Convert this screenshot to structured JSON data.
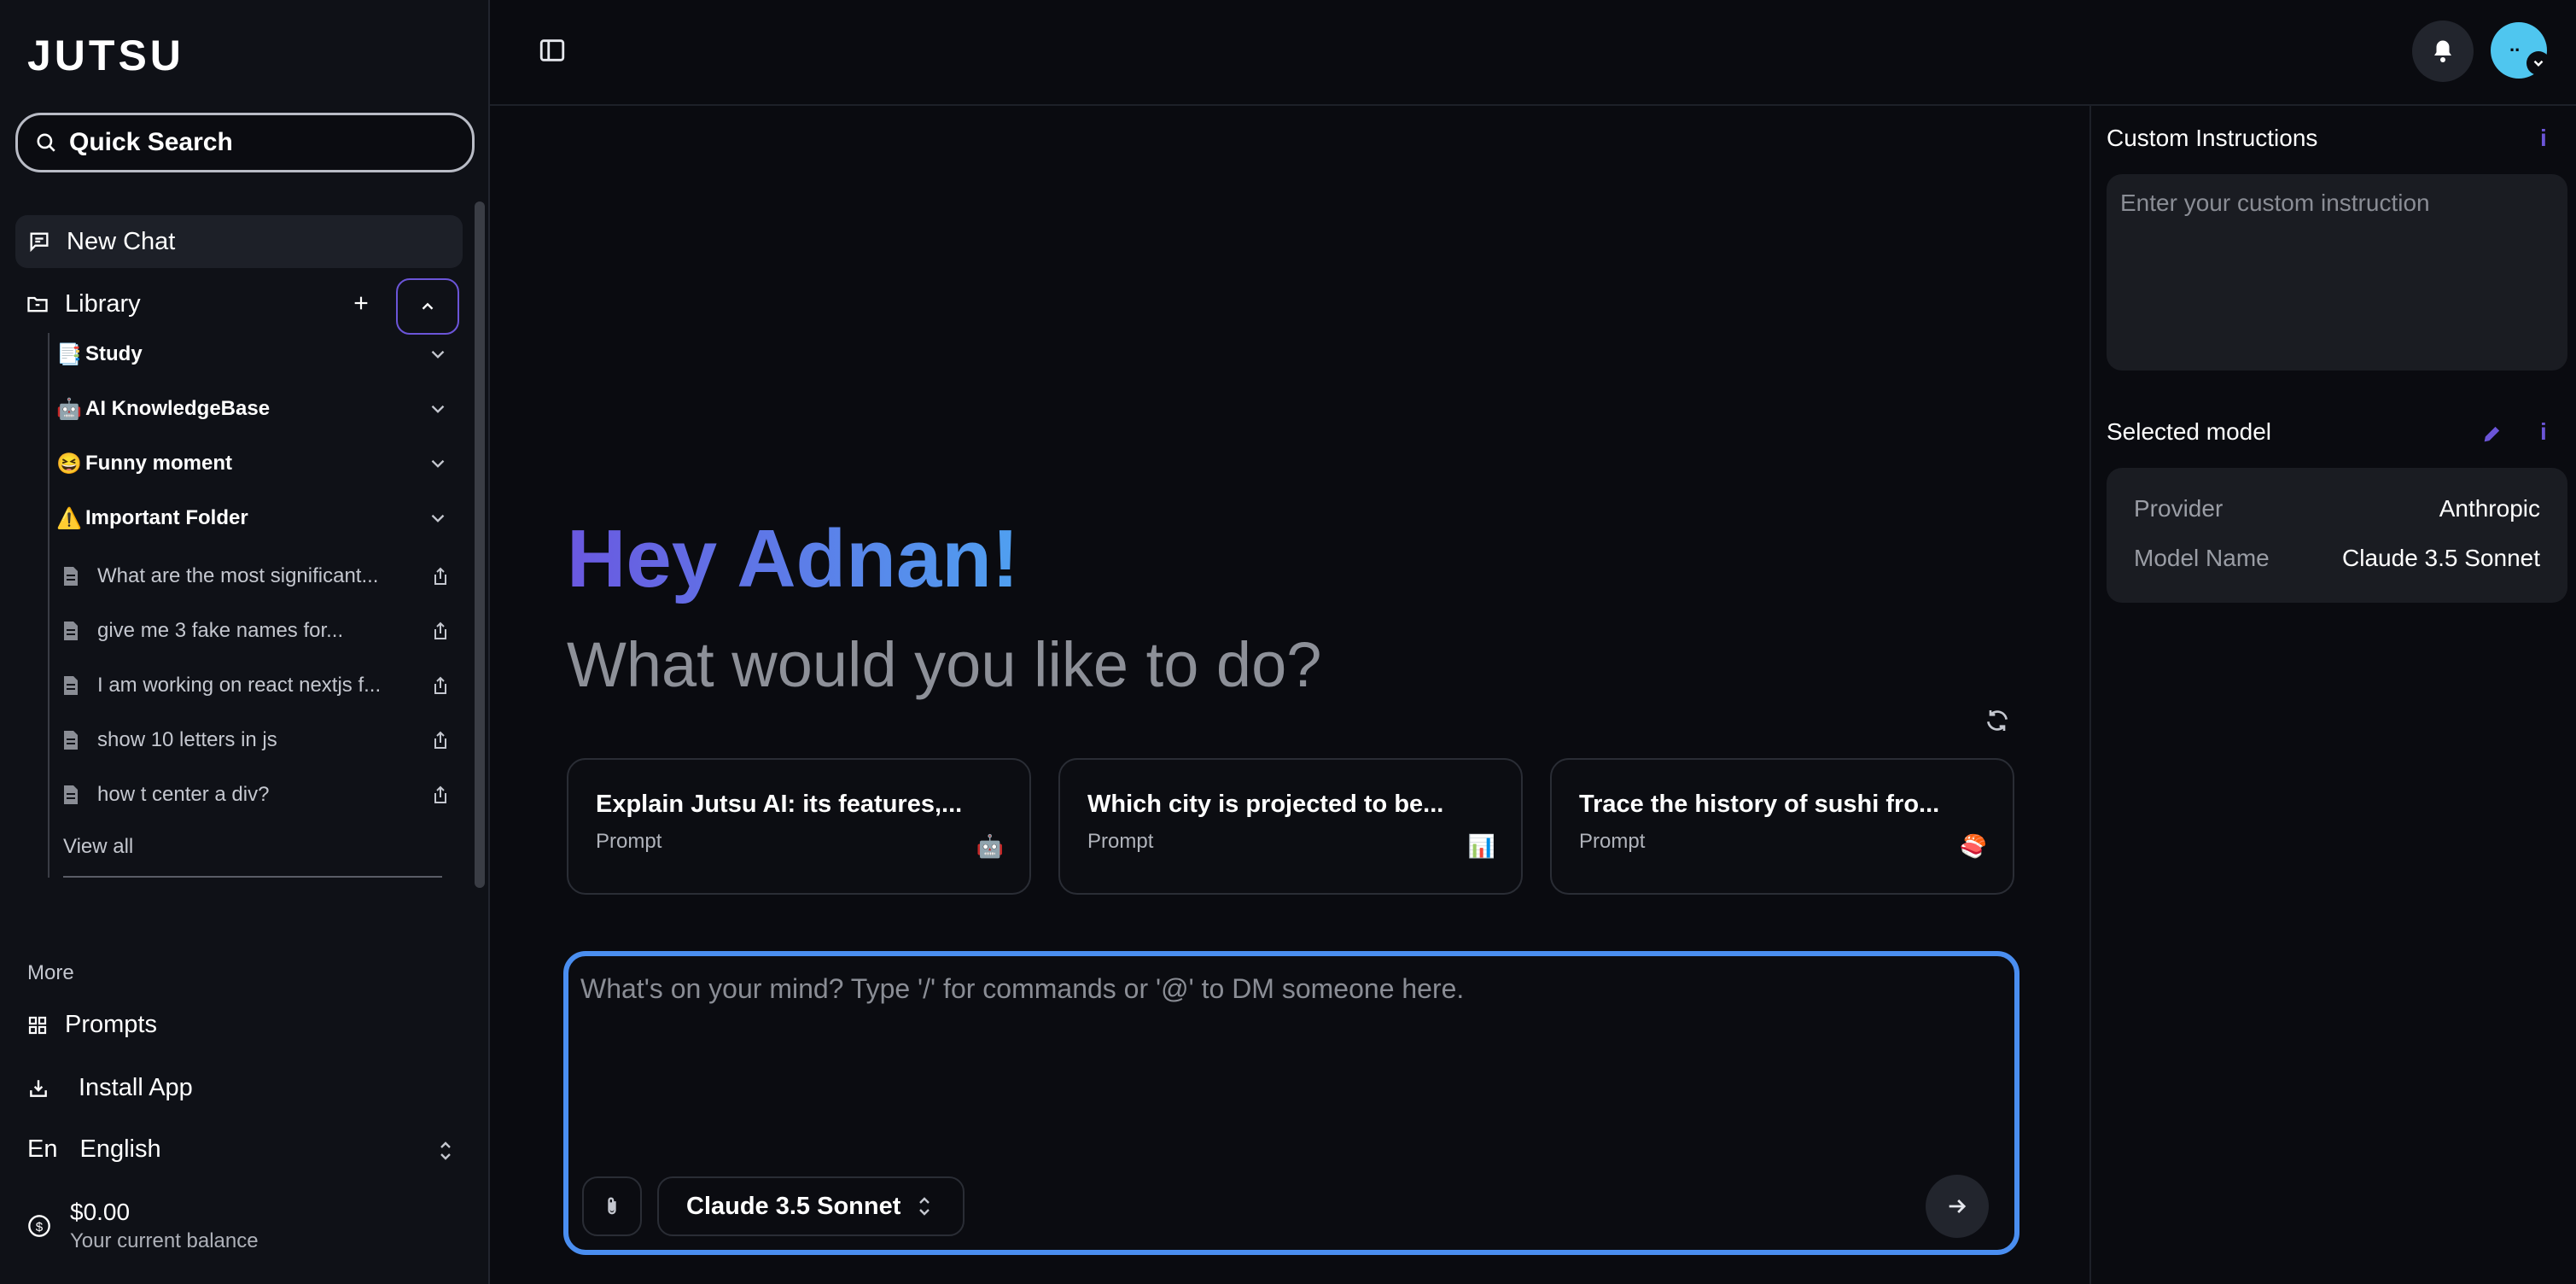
{
  "app": {
    "logo": "JUTSU"
  },
  "sidebar": {
    "search_label": "Quick Search",
    "new_chat": "New Chat",
    "library": "Library",
    "folders": [
      {
        "emoji": "📑",
        "label": "Study"
      },
      {
        "emoji": "🤖",
        "label": "AI KnowledgeBase"
      },
      {
        "emoji": "😆",
        "label": "Funny moment"
      },
      {
        "emoji": "⚠️",
        "label": "Important Folder"
      }
    ],
    "chats": [
      {
        "label": "What are the most significant..."
      },
      {
        "label": "give me 3 fake names for..."
      },
      {
        "label": "I am working on react nextjs f..."
      },
      {
        "label": "show 10 letters in js"
      },
      {
        "label": "how t center a div?"
      }
    ],
    "view_all": "View all",
    "more": "More",
    "prompts": "Prompts",
    "install_app": "Install App",
    "language_code": "En",
    "language": "English",
    "balance": "$0.00",
    "balance_label": "Your current balance"
  },
  "main": {
    "greeting": "Hey Adnan!",
    "subtitle": "What would you like to do?",
    "cards": [
      {
        "title": "Explain Jutsu AI: its features,...",
        "type": "Prompt",
        "emoji": "🤖"
      },
      {
        "title": "Which city is projected to be...",
        "type": "Prompt",
        "emoji": "📊"
      },
      {
        "title": "Trace the history of sushi fro...",
        "type": "Prompt",
        "emoji": "🍣"
      }
    ],
    "composer_placeholder": "What's on your mind? Type '/' for commands or '@' to DM someone here.",
    "model_selector": "Claude 3.5 Sonnet"
  },
  "right_panel": {
    "custom_instructions_title": "Custom Instructions",
    "custom_instructions_placeholder": "Enter your custom instruction",
    "selected_model_title": "Selected model",
    "info_glyph": "i",
    "provider_label": "Provider",
    "provider_value": "Anthropic",
    "model_name_label": "Model Name",
    "model_name_value": "Claude 3.5 Sonnet"
  },
  "colors": {
    "accent": "#6b55d8",
    "composer_border": "#4a8ef0",
    "avatar": "#4fc6ef"
  },
  "icons": [
    "search-icon",
    "chat-icon",
    "folder-icon",
    "plus-icon",
    "chevron-up-icon",
    "chevron-down-icon",
    "document-icon",
    "share-icon",
    "grid-icon",
    "download-icon",
    "selector-icon",
    "dollar-icon",
    "sidebar-toggle-icon",
    "bell-icon",
    "refresh-icon",
    "paperclip-icon",
    "arrow-right-icon",
    "pencil-icon",
    "info-icon"
  ]
}
